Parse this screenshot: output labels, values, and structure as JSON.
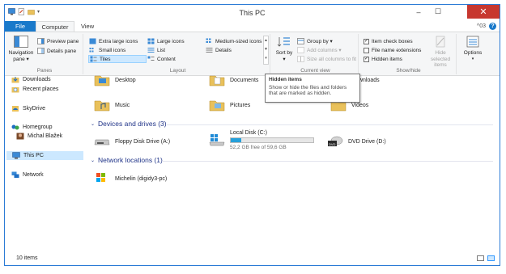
{
  "window": {
    "title": "This PC",
    "minimize_glyph": "–",
    "maximize_glyph": "☐",
    "close_glyph": "✕"
  },
  "tabs": {
    "file": "File",
    "computer": "Computer",
    "view": "View",
    "version": "^03",
    "help": "?"
  },
  "ribbon": {
    "panes": {
      "label": "Panes",
      "navigation_pane": "Navigation pane ▾",
      "preview_pane": "Preview pane",
      "details_pane": "Details pane"
    },
    "layout": {
      "label": "Layout",
      "extra_large_icons": "Extra large icons",
      "large_icons": "Large icons",
      "medium_icons": "Medium-sized icons",
      "small_icons": "Small icons",
      "list": "List",
      "details": "Details",
      "tiles": "Tiles",
      "content": "Content"
    },
    "current_view": {
      "label": "Current view",
      "sort_by": "Sort by ▾",
      "group_by": "Group by ▾",
      "add_columns": "Add columns ▾",
      "size_columns": "Size all columns to fit"
    },
    "show_hide": {
      "label": "Show/hide",
      "item_check_boxes": "Item check boxes",
      "file_name_extensions": "File name extensions",
      "hidden_items": "Hidden items",
      "hide_selected": "Hide selected items"
    },
    "options": {
      "label": "Options"
    }
  },
  "tooltip": {
    "title": "Hidden items",
    "body": "Show or hide the files and folders that are marked as hidden."
  },
  "nav": {
    "downloads": "Downloads",
    "recent_places": "Recent places",
    "skydrive": "SkyDrive",
    "homegroup": "Homegroup",
    "user": "Michal Blažek",
    "this_pc": "This PC",
    "network": "Network"
  },
  "content": {
    "folders": [
      "Desktop",
      "Documents",
      "Downloads",
      "Music",
      "Pictures",
      "Videos"
    ],
    "devices_header": "Devices and drives (3)",
    "floppy": "Floppy Disk Drive (A:)",
    "local_disk": "Local Disk (C:)",
    "local_disk_free": "52,2 GB free of 59,6 GB",
    "local_disk_used_fraction": 0.124,
    "dvd": "DVD Drive (D:)",
    "network_header": "Network locations (1)",
    "network_location": "Michelin (digidy3-pc)"
  },
  "status": {
    "items": "10 items"
  },
  "colors": {
    "accent": "#1979ca",
    "section_header": "#1e3287",
    "close_button": "#c7372f",
    "selection": "#cce8ff",
    "progress": "#26a0da"
  }
}
